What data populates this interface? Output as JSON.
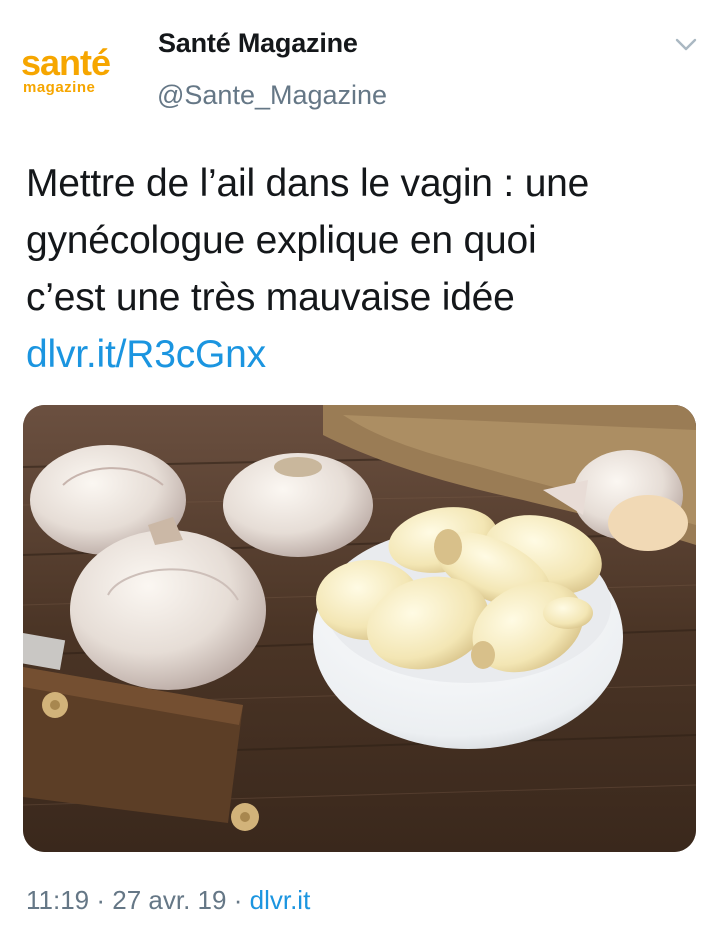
{
  "author": {
    "name": "Santé Magazine",
    "handle": "@Sante_Magazine",
    "logo_text": "santé",
    "logo_subtext": "magazine",
    "logo_color": "#f6a600"
  },
  "tweet": {
    "lines": [
      "Mettre de l’ail dans le vagin : une",
      "gynécologue explique en quoi",
      "c’est une très mauvaise idée"
    ],
    "link": "dlvr.it/R3cGnx"
  },
  "meta": {
    "time": "11:19",
    "separator": "·",
    "date": "27 avr. 19",
    "source": "dlvr.it"
  },
  "colors": {
    "text": "#14171a",
    "secondary": "#657786",
    "link": "#1b95e0"
  },
  "icons": {
    "menu": "chevron-down-icon"
  }
}
